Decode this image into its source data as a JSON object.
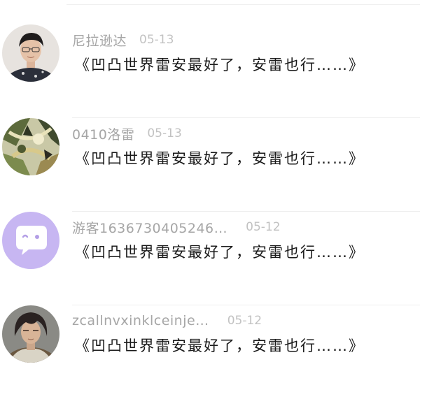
{
  "comments": [
    {
      "username": "尼拉逊达",
      "date": "05-13",
      "text": "《凹凸世界雷安最好了，安雷也行……》",
      "avatar_icon": "user-photo-avatar"
    },
    {
      "username": "0410洛雷",
      "date": "05-13",
      "text": "《凹凸世界雷安最好了，安雷也行……》",
      "avatar_icon": "illustration-avatar"
    },
    {
      "username": "游客1636730405246…",
      "date": "05-12",
      "text": "《凹凸世界雷安最好了，安雷也行……》",
      "avatar_icon": "default-chat-bubble-avatar",
      "avatar_color": "#c7b6f2"
    },
    {
      "username": "zcallnvxinklceinje…",
      "date": "05-12",
      "text": "《凹凸世界雷安最好了，安雷也行……》",
      "avatar_icon": "user-photo-avatar"
    }
  ]
}
